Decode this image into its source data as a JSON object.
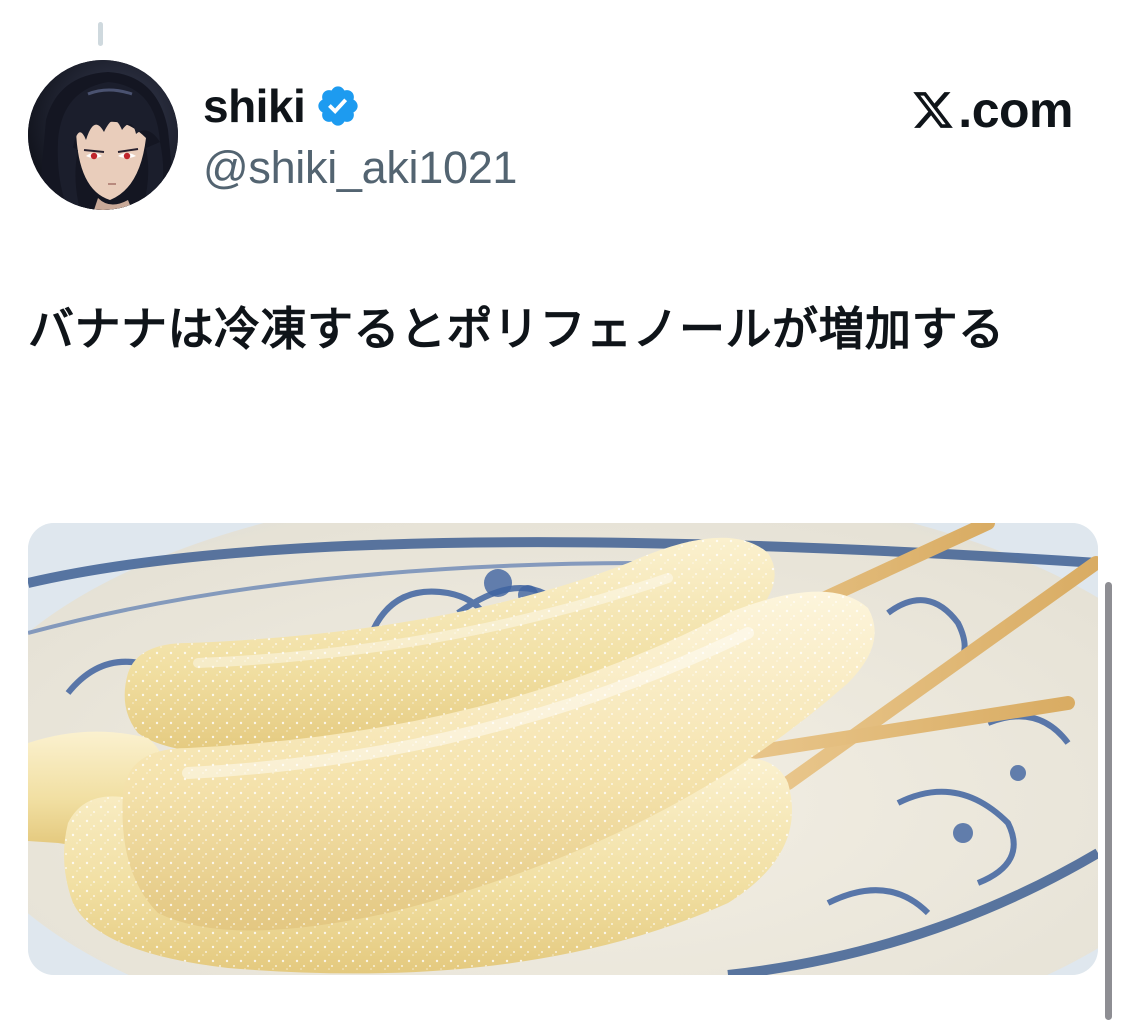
{
  "author": {
    "display_name": "shiki",
    "handle": "@shiki_aki1021",
    "verified": true,
    "avatar_icon": "anime-character-avatar"
  },
  "brand": {
    "logo_icon": "x-logo-icon",
    "text": ".com"
  },
  "tweet": {
    "text": "バナナは冷凍するとポリフェノールが増加する"
  },
  "media": {
    "image_icon": "frozen-banana-photo"
  },
  "colors": {
    "verified_blue": "#1d9bf0",
    "handle_gray": "#536471",
    "text": "#0f1419"
  }
}
